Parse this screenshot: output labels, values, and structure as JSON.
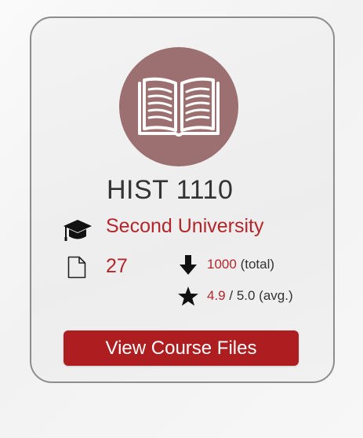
{
  "card": {
    "course_code": "HIST 1110",
    "cover_icon": "open-book-icon",
    "university": {
      "icon": "graduation-cap-icon",
      "name": "Second University"
    },
    "files": {
      "icon": "file-icon",
      "count": "27"
    },
    "downloads": {
      "icon": "download-arrow-icon",
      "value": "1000",
      "suffix": "(total)"
    },
    "rating": {
      "icon": "star-icon",
      "value": "4.9",
      "suffix": "/ 5.0 (avg.)"
    },
    "button_label": "View Course Files"
  },
  "colors": {
    "accent_red": "#b3262b",
    "button_red": "#ae1d20",
    "cover_circle": "#9c7070",
    "text_dark": "#333333"
  }
}
